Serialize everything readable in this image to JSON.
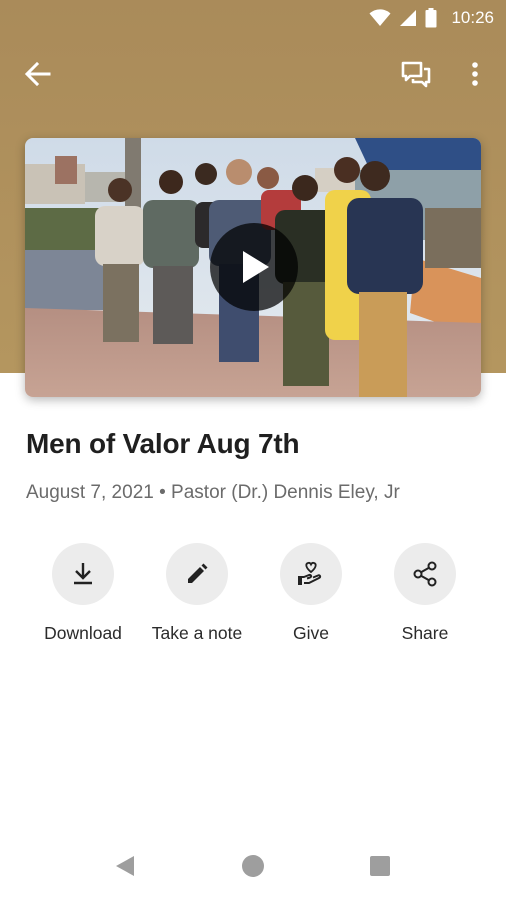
{
  "status_bar": {
    "time": "10:26",
    "icons": [
      "wifi-icon",
      "cell-signal-icon",
      "battery-icon"
    ]
  },
  "app_bar": {
    "back_icon": "arrow-left-icon",
    "actions": [
      "chat-bubbles-icon",
      "more-vert-icon"
    ]
  },
  "media": {
    "thumbnail": "group-photo",
    "play_icon": "play-icon"
  },
  "sermon": {
    "title": "Men of Valor Aug 7th",
    "date": "August 7, 2021",
    "separator": " • ",
    "speaker": "Pastor (Dr.) Dennis Eley, Jr"
  },
  "actions": [
    {
      "label": "Download",
      "icon": "download-icon"
    },
    {
      "label": "Take a note",
      "icon": "pencil-icon"
    },
    {
      "label": "Give",
      "icon": "hand-heart-icon"
    },
    {
      "label": "Share",
      "icon": "share-icon"
    }
  ],
  "nav_bar": {
    "buttons": [
      "nav-back-icon",
      "nav-home-icon",
      "nav-recents-icon"
    ]
  },
  "colors": {
    "header": "#b09260",
    "action_circle": "#ececec",
    "title_text": "#1f1f1f",
    "meta_text": "#6b6b6b"
  }
}
